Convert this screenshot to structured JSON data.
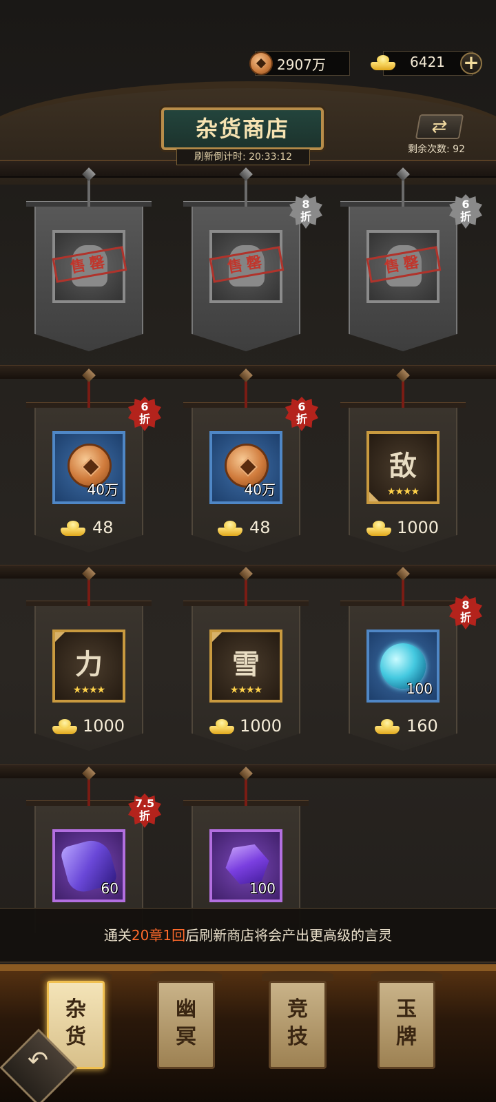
{
  "currency": {
    "copper": "2907万",
    "gold": "6421",
    "plus": "+"
  },
  "header": {
    "title": "杂货商店",
    "refresh_timer": "刷新倒计时: 20:33:12",
    "refresh_icon": "⇄",
    "refresh_count": "剩余次数: 92"
  },
  "shop": {
    "sold_stamp": "售罄",
    "row1": [
      {
        "discount": ""
      },
      {
        "discount_num": "8",
        "discount_unit": "折"
      },
      {
        "discount_num": "6",
        "discount_unit": "折"
      }
    ],
    "row2": [
      {
        "discount_num": "6",
        "discount_unit": "折",
        "qty": "40万",
        "price": "48"
      },
      {
        "discount_num": "6",
        "discount_unit": "折",
        "qty": "40万",
        "price": "48"
      },
      {
        "glyph": "敌",
        "stars": "★★★★",
        "price": "1000"
      }
    ],
    "row3": [
      {
        "glyph": "力",
        "stars": "★★★★",
        "price": "1000"
      },
      {
        "glyph": "雪",
        "stars": "★★★★",
        "price": "1000"
      },
      {
        "discount_num": "8",
        "discount_unit": "折",
        "qty": "100",
        "price": "160"
      }
    ],
    "row4": [
      {
        "discount_num": "7.5",
        "discount_unit": "折",
        "qty": "60"
      },
      {
        "qty": "100"
      }
    ]
  },
  "hint": {
    "pre": "通关",
    "chapter": "20章1回",
    "post": "后刷新商店将会产出更高级的言灵"
  },
  "tabs": [
    {
      "label": "杂货"
    },
    {
      "label": "幽冥"
    },
    {
      "label": "竞技"
    },
    {
      "label": "玉牌"
    }
  ],
  "back_icon": "↶",
  "colors": {
    "accent_red": "#b4231c",
    "highlight": "#ff6a2b",
    "gold": "#f0c22c"
  }
}
